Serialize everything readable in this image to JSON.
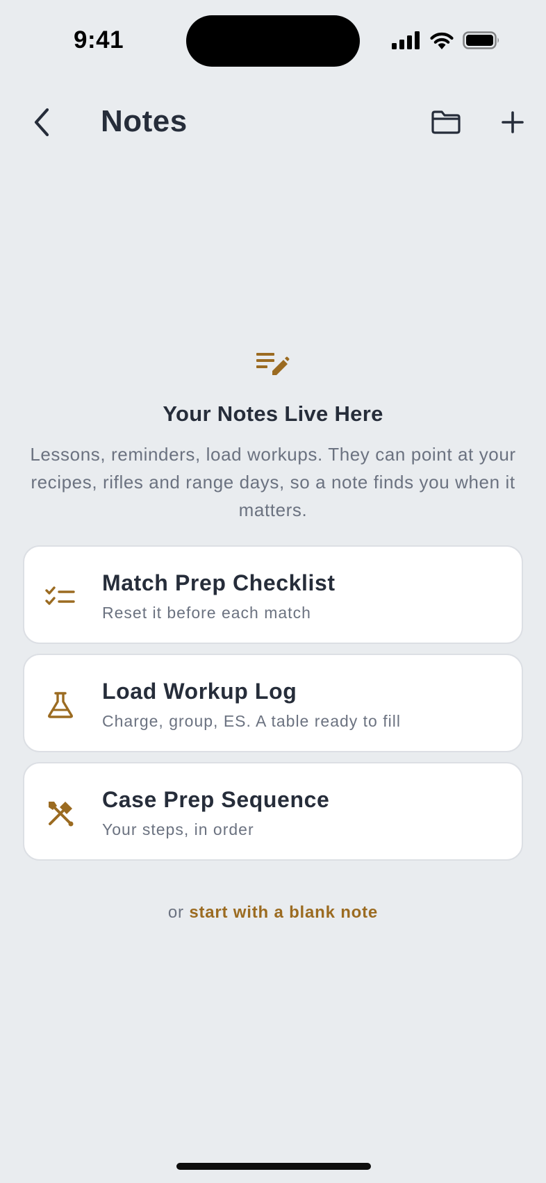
{
  "status_bar": {
    "time": "9:41"
  },
  "nav": {
    "title": "Notes"
  },
  "empty_state": {
    "title": "Your Notes Live Here",
    "description": "Lessons, reminders, load workups. They can point at your recipes, rifles and range days, so a note finds you when it matters."
  },
  "templates": [
    {
      "title": "Match Prep Checklist",
      "subtitle": "Reset it before each match",
      "icon": "checklist-icon"
    },
    {
      "title": "Load Workup Log",
      "subtitle": "Charge, group, ES. A table ready to fill",
      "icon": "flask-icon"
    },
    {
      "title": "Case Prep Sequence",
      "subtitle": "Your steps, in order",
      "icon": "tools-icon"
    }
  ],
  "footer": {
    "or_text": "or",
    "blank_note_label": "start with a blank note"
  },
  "colors": {
    "accent": "#9b6b21",
    "text": "#262d3a",
    "muted": "#6b7280",
    "background": "#e9ecef"
  }
}
